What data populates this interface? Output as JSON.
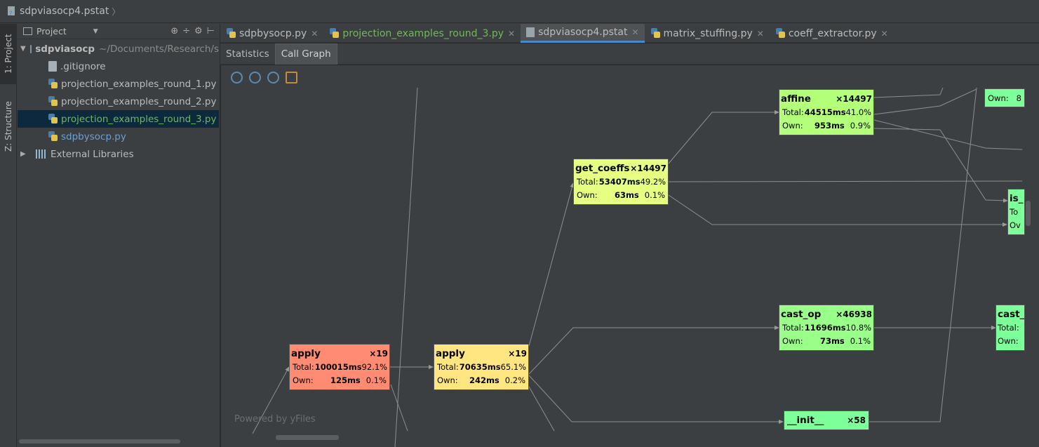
{
  "breadcrumb": {
    "file": "sdpviasocp4.pstat",
    "chevron": "〉"
  },
  "side_tabs": {
    "project": "1: Project",
    "structure": "Z: Structure"
  },
  "project_panel": {
    "title": "Project",
    "tools": [
      "⊕",
      "÷",
      "⚙",
      "⊢"
    ],
    "root": {
      "name": "sdpviasocp",
      "path": "~/Documents/Research/s"
    },
    "items": [
      {
        "label": ".gitignore",
        "kind": "doc"
      },
      {
        "label": "projection_examples_round_1.py",
        "kind": "py"
      },
      {
        "label": "projection_examples_round_2.py",
        "kind": "py"
      },
      {
        "label": "projection_examples_round_3.py",
        "kind": "py",
        "selected": true
      },
      {
        "label": "sdpbysocp.py",
        "kind": "py"
      }
    ],
    "external": "External Libraries"
  },
  "editor_tabs": [
    {
      "label": "sdpbysocp.py"
    },
    {
      "label": "projection_examples_round_3.py"
    },
    {
      "label": "sdpviasocp4.pstat"
    },
    {
      "label": "matrix_stuffing.py"
    },
    {
      "label": "coeff_extractor.py"
    }
  ],
  "sub_tabs": [
    "Statistics",
    "Call Graph"
  ],
  "graph": {
    "powered_by": "Powered by yFiles",
    "nodes": [
      {
        "id": "apply1",
        "name": "apply",
        "count": "×19",
        "total": "100015ms",
        "total_pct": "92.1%",
        "own": "125ms",
        "own_pct": "0.1%"
      },
      {
        "id": "apply2",
        "name": "apply",
        "count": "×19",
        "total": "70635ms",
        "total_pct": "65.1%",
        "own": "242ms",
        "own_pct": "0.2%"
      },
      {
        "id": "get_coeffs",
        "name": "get_coeffs",
        "count": "×14497",
        "total": "53407ms",
        "total_pct": "49.2%",
        "own": "63ms",
        "own_pct": "0.1%"
      },
      {
        "id": "affine",
        "name": "affine",
        "count": "×14497",
        "total": "44515ms",
        "total_pct": "41.0%",
        "own": "953ms",
        "own_pct": "0.9%"
      },
      {
        "id": "cast_op",
        "name": "cast_op",
        "count": "×46938",
        "total": "11696ms",
        "total_pct": "10.8%",
        "own": "73ms",
        "own_pct": "0.1%"
      },
      {
        "id": "init",
        "name": "__init__",
        "count": "×58"
      },
      {
        "id": "is_partial",
        "name": "is_",
        "row1": "To",
        "row2": "Ov"
      },
      {
        "id": "cast_partial",
        "name": "cast_",
        "row1": "Total:",
        "row2": "Own:"
      },
      {
        "id": "own_partial",
        "own_label": "Own:",
        "own_val": "8"
      }
    ],
    "labels": {
      "total": "Total:",
      "own": "Own:"
    }
  }
}
